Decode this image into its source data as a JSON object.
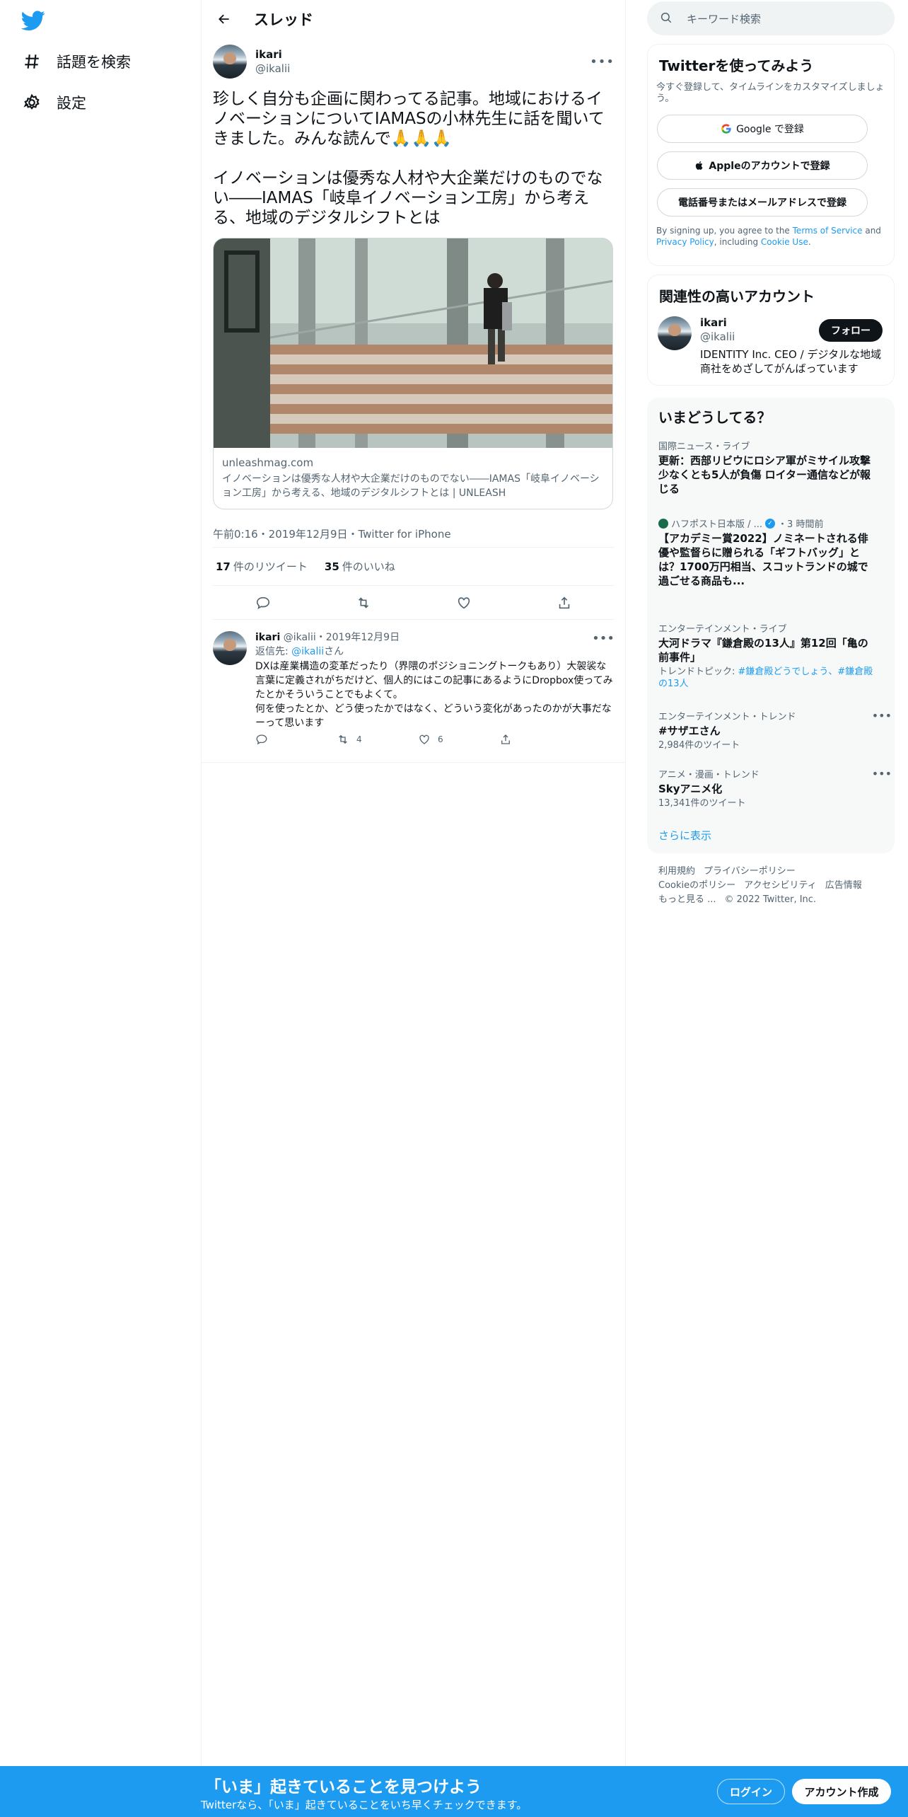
{
  "nav": {
    "explore_label": "話題を検索",
    "settings_label": "設定"
  },
  "header": {
    "title": "スレッド"
  },
  "main_tweet": {
    "name": "ikari",
    "handle": "@ikalii",
    "text": "珍しく自分も企画に関わってる記事。地域におけるイノベーションについてIAMASの小林先生に話を聞いてきました。みんな読んで🙏🙏🙏\n\nイノベーションは優秀な人材や大企業だけのものでない――IAMAS「岐阜イノベーション工房」から考える、地域のデジタルシフトとは",
    "card_domain": "unleashmag.com",
    "card_title": "イノベーションは優秀な人材や大企業だけのものでない――IAMAS「岐阜イノベーション工房」から考える、地域のデジタルシフトとは | UNLEASH",
    "timestamp": "午前0:16・2019年12月9日・Twitter for iPhone",
    "retweets_count": "17",
    "retweets_label": "件のリツイート",
    "likes_count": "35",
    "likes_label": "件のいいね"
  },
  "reply_tweet": {
    "name": "ikari",
    "handle_date": "@ikalii・2019年12月9日",
    "reply_to_prefix": "返信先: ",
    "reply_to_handle": "@ikalii",
    "reply_to_suffix": "さん",
    "text": "DXは産業構造の変革だったり（界隈のポジショニングトークもあり）大袈裟な言葉に定義されがちだけど、個人的にはこの記事にあるようにDropbox使ってみたとかそういうことでもよくて。\n何を使ったとか、どう使ったかではなく、どういう変化があったのかが大事だなーって思います",
    "retweets": "4",
    "likes": "6"
  },
  "search": {
    "placeholder": "キーワード検索"
  },
  "signup": {
    "title": "Twitterを使ってみよう",
    "subtitle": "今すぐ登録して、タイムラインをカスタマイズしましょう。",
    "google_label": "Google で登録",
    "apple_label": "Appleのアカウントで登録",
    "phone_label": "電話番号またはメールアドレスで登録",
    "fine_1": "By signing up, you agree to the ",
    "terms": "Terms of Service",
    "fine_2": " and ",
    "privacy": "Privacy Policy",
    "fine_3": ", including ",
    "cookie": "Cookie Use",
    "fine_4": "."
  },
  "related": {
    "title": "関連性の高いアカウント",
    "name": "ikari",
    "handle": "@ikalii",
    "bio": "IDENTITY Inc. CEO / デジタルな地域商社をめざしてがんばっています",
    "follow_label": "フォロー"
  },
  "trends": {
    "title": "いまどうしてる？",
    "items": [
      {
        "context": "国際ニュース・ライブ",
        "headline": "更新：西部リビウにロシア軍がミサイル攻撃 少なくとも5人が負傷 ロイター通信などが報じる"
      },
      {
        "source": "ハフポスト日本版 / ...",
        "time": "・3 時間前",
        "headline": "【アカデミー賞2022】ノミネートされる俳優や監督らに贈られる「ギフトバッグ」とは？1700万円相当、スコットランドの城で過ごせる商品も..."
      },
      {
        "context": "エンターテインメント・ライブ",
        "headline": "大河ドラマ『鎌倉殿の13人』第12回「亀の前事件」",
        "meta_prefix": "トレンドトピック: ",
        "meta_tags": "#鎌倉殿どうでしょう、#鎌倉殿の13人"
      },
      {
        "context": "エンターテインメント・トレンド",
        "headline": "#サザエさん",
        "meta": "2,984件のツイート"
      },
      {
        "context": "アニメ・漫画・トレンド",
        "headline": "Skyアニメ化",
        "meta": "13,341件のツイート"
      }
    ],
    "show_more": "さらに表示"
  },
  "footer": {
    "terms": "利用規約",
    "privacy": "プライバシーポリシー",
    "cookie": "Cookieのポリシー",
    "accessibility": "アクセシビリティ",
    "ads": "広告情報",
    "more": "もっと見る ...",
    "copyright": "© 2022 Twitter, Inc."
  },
  "bottombar": {
    "headline": "「いま」起きていることを見つけよう",
    "sub": "Twitterなら、「いま」起きていることをいち早くチェックできます。",
    "login_label": "ログイン",
    "signup_label": "アカウント作成"
  },
  "colors": {
    "accent": "#1d9bf0",
    "text": "#0f1419",
    "muted": "#536471"
  }
}
